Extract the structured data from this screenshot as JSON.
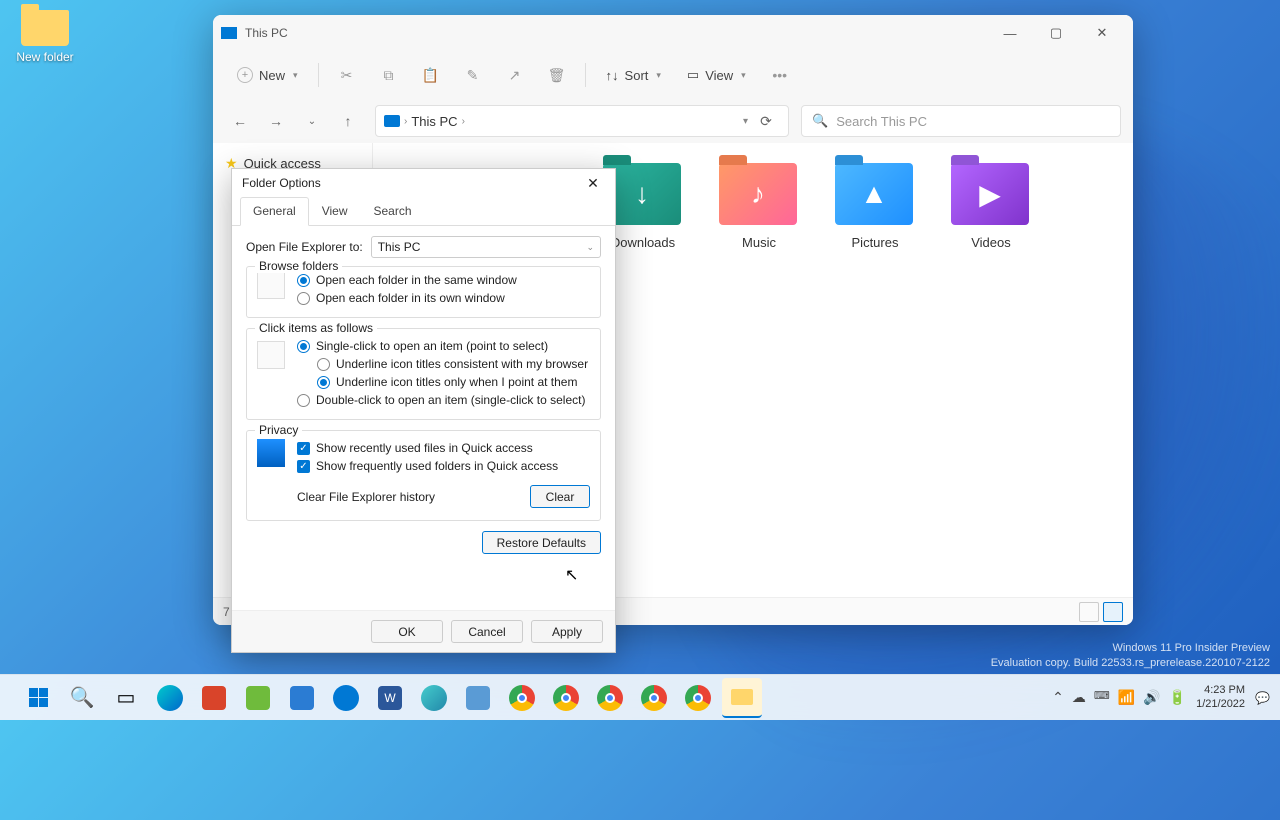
{
  "desktop": {
    "icon_label": "New folder"
  },
  "explorer": {
    "title": "This PC",
    "toolbar": {
      "new": "New",
      "sort": "Sort",
      "view": "View"
    },
    "breadcrumb": "This PC",
    "breadcrumb_refresh_dropdown": "▾",
    "search_placeholder": "Search This PC",
    "sidebar": {
      "quick_access": "Quick access"
    },
    "folders": [
      {
        "label": "Downloads",
        "color": "green",
        "glyph": "↓"
      },
      {
        "label": "Music",
        "color": "orange",
        "glyph": "♪"
      },
      {
        "label": "Pictures",
        "color": "blue",
        "glyph": "▲"
      },
      {
        "label": "Videos",
        "color": "purple",
        "glyph": "▶"
      }
    ],
    "status_count": "7"
  },
  "dialog": {
    "title": "Folder Options",
    "tabs": {
      "general": "General",
      "view": "View",
      "search": "Search"
    },
    "open_label": "Open File Explorer to:",
    "open_value": "This PC",
    "browse": {
      "legend": "Browse folders",
      "same": "Open each folder in the same window",
      "own": "Open each folder in its own window"
    },
    "click": {
      "legend": "Click items as follows",
      "single": "Single-click to open an item (point to select)",
      "underline_browser": "Underline icon titles consistent with my browser",
      "underline_point": "Underline icon titles only when I point at them",
      "double": "Double-click to open an item (single-click to select)"
    },
    "privacy": {
      "legend": "Privacy",
      "recent_files": "Show recently used files in Quick access",
      "frequent_folders": "Show frequently used folders in Quick access",
      "clear_label": "Clear File Explorer history",
      "clear_btn": "Clear"
    },
    "restore": "Restore Defaults",
    "ok": "OK",
    "cancel": "Cancel",
    "apply": "Apply"
  },
  "watermark": {
    "line1": "Windows 11 Pro Insider Preview",
    "line2": "Evaluation copy. Build 22533.rs_prerelease.220107-2122"
  },
  "tray": {
    "time": "4:23 PM",
    "date": "1/21/2022"
  }
}
